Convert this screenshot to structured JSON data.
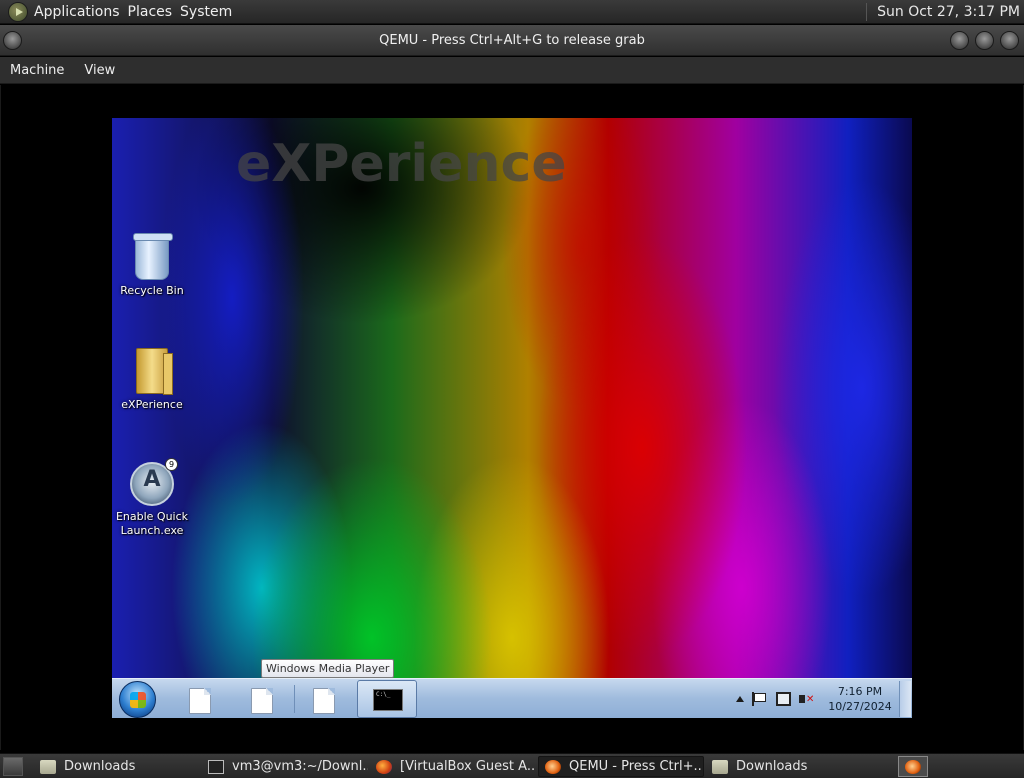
{
  "top_panel": {
    "menus": [
      "Applications",
      "Places",
      "System"
    ],
    "clock": "Sun Oct 27,  3:17 PM"
  },
  "window": {
    "title": "QEMU - Press Ctrl+Alt+G to release grab",
    "menubar": [
      "Machine",
      "View"
    ]
  },
  "guest": {
    "watermark": "eXPerience",
    "desktop_icons": [
      {
        "label": "Recycle Bin",
        "icon": "recycle-bin-icon"
      },
      {
        "label": "eXPerience",
        "icon": "folder-icon"
      },
      {
        "label": "Enable Quick Launch.exe",
        "icon": "quick-launch-app-icon"
      }
    ],
    "tooltip": "Windows Media Player",
    "taskbar": {
      "pinned_icons": [
        "file-icon",
        "file-icon",
        "file-icon"
      ],
      "cmd_icon_text": "C:\\_",
      "clock_time": "7:16 PM",
      "clock_date": "10/27/2024"
    }
  },
  "bottom_panel": {
    "tasks": [
      {
        "label": "Downloads",
        "icon": "folder-icon"
      },
      {
        "label": "vm3@vm3:~/Downl...",
        "icon": "terminal-icon"
      },
      {
        "label": "[VirtualBox Guest A...",
        "icon": "firefox-icon"
      },
      {
        "label": "QEMU - Press Ctrl+...",
        "icon": "qemu-icon",
        "active": true
      },
      {
        "label": "Downloads",
        "icon": "folder-icon"
      }
    ]
  }
}
